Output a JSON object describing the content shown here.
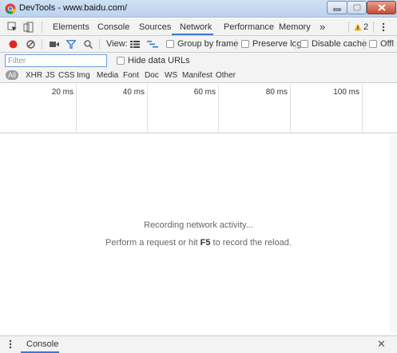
{
  "window": {
    "title": "DevTools - www.baidu.com/"
  },
  "main_tabs": {
    "items": [
      {
        "label": "Elements"
      },
      {
        "label": "Console"
      },
      {
        "label": "Sources"
      },
      {
        "label": "Network",
        "active": true
      },
      {
        "label": "Performance"
      },
      {
        "label": "Memory"
      }
    ],
    "more_label": "»",
    "warning_count": "2"
  },
  "network_toolbar": {
    "view_label": "View:",
    "group_by_frame": "Group by frame",
    "preserve_log": "Preserve log",
    "disable_cache": "Disable cache",
    "offline": "Offl"
  },
  "filter": {
    "placeholder": "Filter",
    "hide_data_urls": "Hide data URLs"
  },
  "resource_types": [
    "All",
    "XHR",
    "JS",
    "CSS",
    "Img",
    "Media",
    "Font",
    "Doc",
    "WS",
    "Manifest",
    "Other"
  ],
  "timeline": {
    "ticks": [
      "20 ms",
      "40 ms",
      "60 ms",
      "80 ms",
      "100 ms"
    ]
  },
  "empty_state": {
    "line1": "Recording network activity...",
    "line2_before": "Perform a request or hit ",
    "line2_key": "F5",
    "line2_after": " to record the reload."
  },
  "drawer": {
    "tab_label": "Console"
  },
  "colors": {
    "record_red": "#e0261f",
    "accent_blue": "#3879d9",
    "warning_yellow": "#f2b21e"
  }
}
